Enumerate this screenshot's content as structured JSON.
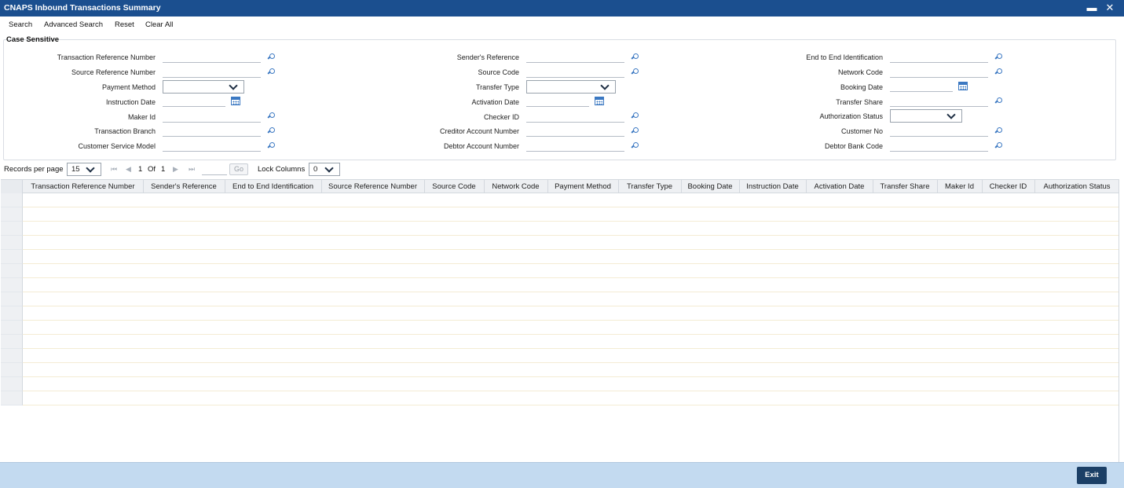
{
  "window": {
    "title": "CNAPS Inbound Transactions Summary",
    "minimize_glyph": "▬",
    "close_glyph": "✕"
  },
  "toolbar": {
    "search": "Search",
    "advanced_search": "Advanced Search",
    "reset": "Reset",
    "clear_all": "Clear All"
  },
  "criteria": {
    "case_sensitive": "Case Sensitive",
    "fields": {
      "transaction_reference_number": "Transaction Reference Number",
      "source_reference_number": "Source Reference Number",
      "payment_method": "Payment Method",
      "instruction_date": "Instruction Date",
      "maker_id": "Maker Id",
      "transaction_branch": "Transaction Branch",
      "customer_service_model": "Customer Service Model",
      "senders_reference": "Sender's Reference",
      "source_code": "Source Code",
      "transfer_type": "Transfer Type",
      "activation_date": "Activation Date",
      "checker_id": "Checker ID",
      "creditor_account_number": "Creditor Account Number",
      "debtor_account_number": "Debtor Account Number",
      "end_to_end_identification": "End to End Identification",
      "network_code": "Network Code",
      "booking_date": "Booking Date",
      "transfer_share": "Transfer Share",
      "authorization_status": "Authorization Status",
      "customer_no": "Customer No",
      "debtor_bank_code": "Debtor Bank Code"
    },
    "values": {
      "payment_method": "",
      "transfer_type": "",
      "authorization_status": ""
    }
  },
  "pager": {
    "records_per_page_label": "Records per page",
    "records_per_page": "15",
    "current_page": "1",
    "of_label": "Of",
    "total_pages": "1",
    "go_label": "Go",
    "lock_columns_label": "Lock Columns",
    "lock_columns": "0"
  },
  "grid": {
    "columns": [
      "Transaction Reference Number",
      "Sender's Reference",
      "End to End Identification",
      "Source Reference Number",
      "Source Code",
      "Network Code",
      "Payment Method",
      "Transfer Type",
      "Booking Date",
      "Instruction Date",
      "Activation Date",
      "Transfer Share",
      "Maker Id",
      "Checker ID",
      "Authorization Status"
    ],
    "empty_rows": 15
  },
  "footer": {
    "exit": "Exit"
  },
  "colors": {
    "title_bar": "#1b4f8f",
    "footer": "#c3daf0",
    "exit_button": "#1b3f66",
    "icon": "#3b78c2"
  }
}
